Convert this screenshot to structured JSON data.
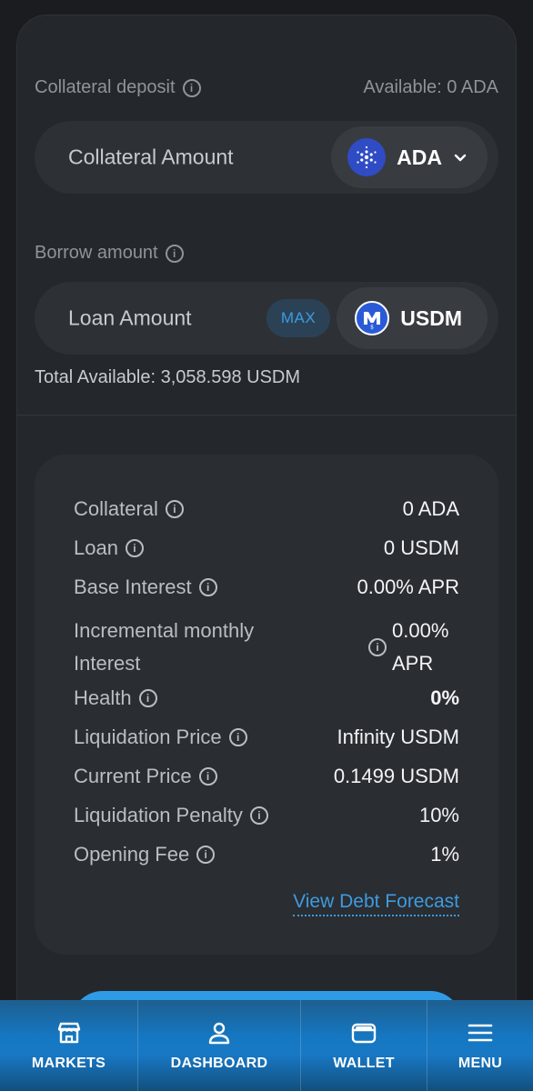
{
  "collateral": {
    "label": "Collateral deposit",
    "available": "Available: 0 ADA",
    "input_placeholder": "Collateral Amount",
    "token": "ADA"
  },
  "borrow": {
    "label": "Borrow amount",
    "input_placeholder": "Loan Amount",
    "max_label": "MAX",
    "token": "USDM",
    "total_available": "Total Available: 3,058.598 USDM"
  },
  "summary": {
    "rows": [
      {
        "label": "Collateral",
        "value": "0 ADA"
      },
      {
        "label": "Loan",
        "value": "0 USDM"
      },
      {
        "label": "Base Interest",
        "value": "0.00% APR"
      },
      {
        "label_line1": "Incremental monthly",
        "label_line2": "Interest",
        "value_line1": "0.00%",
        "value_line2": "APR"
      },
      {
        "label": "Health",
        "value": "0%"
      },
      {
        "label": "Liquidation Price",
        "value": "Infinity USDM"
      },
      {
        "label": "Current Price",
        "value": "0.1499 USDM"
      },
      {
        "label": "Liquidation Penalty",
        "value": "10%"
      },
      {
        "label": "Opening Fee",
        "value": "1%"
      }
    ],
    "forecast_link": "View Debt Forecast"
  },
  "nav": {
    "items": [
      {
        "label": "MARKETS",
        "icon": "store-icon"
      },
      {
        "label": "DASHBOARD",
        "icon": "user-icon"
      },
      {
        "label": "WALLET",
        "icon": "wallet-icon"
      },
      {
        "label": "MENU",
        "icon": "hamburger-icon"
      }
    ]
  },
  "colors": {
    "accent": "#3d9be0",
    "card_bg": "#24272b",
    "nav_bg": "#1577c2"
  }
}
